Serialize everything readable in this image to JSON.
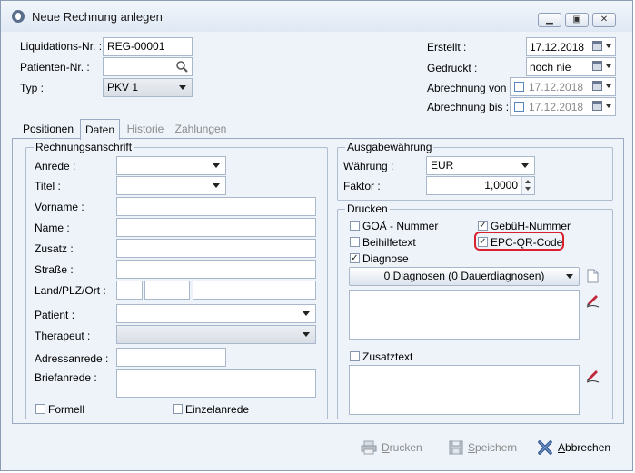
{
  "window": {
    "title": "Neue Rechnung anlegen",
    "icon": "app-logo-icon"
  },
  "header": {
    "liquidations_label": "Liquidations-Nr. :",
    "liquidations_value": "REG-00001",
    "patienten_label": "Patienten-Nr. :",
    "patienten_value": "",
    "typ_label": "Typ :",
    "typ_value": "PKV 1",
    "erstellt_label": "Erstellt :",
    "erstellt_value": "17.12.2018",
    "gedruckt_label": "Gedruckt :",
    "gedruckt_value": "noch nie",
    "abrechnung_von_label": "Abrechnung von :",
    "abrechnung_von_value": "17.12.2018",
    "abrechnung_von_checked": false,
    "abrechnung_bis_label": "Abrechnung bis :",
    "abrechnung_bis_value": "17.12.2018",
    "abrechnung_bis_checked": false
  },
  "tabs": [
    {
      "label": "Positionen",
      "active": false
    },
    {
      "label": "Daten",
      "active": true
    },
    {
      "label": "Historie",
      "active": false
    },
    {
      "label": "Zahlungen",
      "active": false
    }
  ],
  "rechnungsanschrift": {
    "title": "Rechnungsanschrift",
    "anrede_label": "Anrede :",
    "titel_label": "Titel :",
    "vorname_label": "Vorname :",
    "name_label": "Name :",
    "zusatz_label": "Zusatz :",
    "strasse_label": "Straße :",
    "land_plz_ort_label": "Land/PLZ/Ort :",
    "patient_label": "Patient :",
    "therapeut_label": "Therapeut :",
    "adressanrede_label": "Adressanrede :",
    "briefanrede_label": "Briefanrede :",
    "formell_label": "Formell",
    "formell_checked": false,
    "einzelanrede_label": "Einzelanrede",
    "einzelanrede_checked": false
  },
  "ausgabewaehrung": {
    "title": "Ausgabewährung",
    "waehrung_label": "Währung :",
    "waehrung_value": "EUR",
    "faktor_label": "Faktor :",
    "faktor_value": "1,0000"
  },
  "drucken": {
    "title": "Drucken",
    "goae_label": "GOÄ - Nummer",
    "goae_checked": false,
    "gebueh_label": "GebüH-Nummer",
    "gebueh_checked": true,
    "beihilfetext_label": "Beihilfetext",
    "beihilfetext_checked": false,
    "epc_label": "EPC-QR-Code",
    "epc_checked": true,
    "diagnose_label": "Diagnose",
    "diagnose_checked": true,
    "diagnosen_value": "0 Diagnosen (0 Dauerdiagnosen)",
    "zusatztext_label": "Zusatztext",
    "zusatztext_checked": false,
    "highlight_color": "#d8212c"
  },
  "footer": {
    "drucken_prefix": "D",
    "drucken_rest": "rucken",
    "speichern_prefix": "S",
    "speichern_rest": "peichern",
    "abbrechen_prefix": "A",
    "abbrechen_rest": "bbrechen"
  }
}
